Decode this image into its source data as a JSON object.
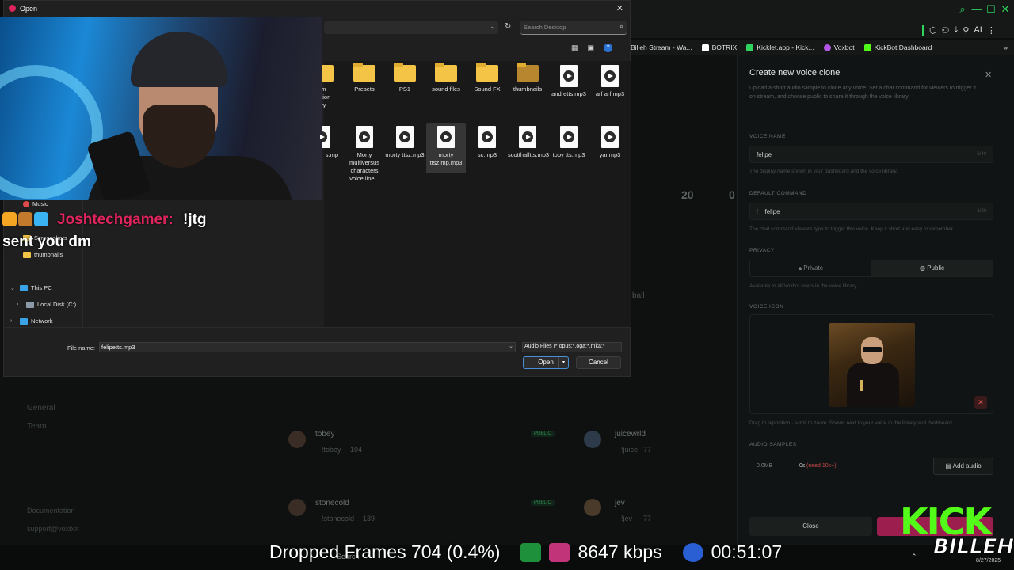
{
  "browser": {
    "bookmarks": [
      {
        "label": "Billeh Stream - Wa...",
        "color": "#222222"
      },
      {
        "label": "BOTRIX",
        "color": "#ffffff"
      },
      {
        "label": "Kicklet.app - Kick...",
        "color": "#2fd45e"
      },
      {
        "label": "Voxbot",
        "color": "#b156e6"
      },
      {
        "label": "KickBot Dashboard",
        "color": "#53fc18"
      }
    ],
    "toolbar_ai_label": "AI"
  },
  "dashboard": {
    "stat_value": "20",
    "stat_value2": "0",
    "nav": [
      "General",
      "Team"
    ],
    "footer_links": [
      "Documentation",
      "support@voxbot"
    ],
    "rows": [
      {
        "name": "tobey",
        "cmd": "!tobey",
        "count": "104"
      },
      {
        "name": "juicewrld",
        "cmd": "!juice",
        "count": "77"
      },
      {
        "name": "stonecold",
        "cmd": "!stonecold",
        "count": "139"
      },
      {
        "name": "jev",
        "cmd": "!jev",
        "count": "77"
      }
    ],
    "row_partial": "ball",
    "badge": "PUBLIC"
  },
  "panel": {
    "title": "Create new voice clone",
    "description": "Upload a short audio sample to clone any voice. Set a chat command for viewers to trigger it on stream, and choose public to share it through the voice library.",
    "voice_name_label": "VOICE NAME",
    "voice_name_value": "felipe",
    "voice_name_count": "6/40",
    "voice_name_hint": "The display name shown in your dashboard and the voice library.",
    "command_label": "DEFAULT COMMAND",
    "command_prefix": "!",
    "command_value": "felipe",
    "command_count": "6/20",
    "command_hint": "The chat command viewers type to trigger this voice. Keep it short and easy to remember.",
    "privacy_label": "PRIVACY",
    "privacy_private": "Private",
    "privacy_public": "Public",
    "privacy_hint": "Available to all Voxbot users in the voice library.",
    "icon_label": "VOICE ICON",
    "icon_hint": "Drag to reposition · scroll to zoom. Shown next to your voice in the library and dashboard.",
    "audio_label": "AUDIO SAMPLES",
    "audio_size": "0.0MB",
    "audio_duration": "0s",
    "audio_need": "(need 10s+)",
    "add_audio_label": "Add audio",
    "close_label": "Close"
  },
  "dialog": {
    "title": "Open",
    "search_placeholder": "Search Desktop",
    "files_row1": [
      {
        "label": "um ation ary",
        "kind": "folder"
      },
      {
        "label": "Presets",
        "kind": "folder"
      },
      {
        "label": "PS1",
        "kind": "folder"
      },
      {
        "label": "sound files",
        "kind": "folder"
      },
      {
        "label": "Sound FX",
        "kind": "folder"
      },
      {
        "label": "thumbnails",
        "kind": "folder"
      },
      {
        "label": "andretts.mp3",
        "kind": "audio"
      },
      {
        "label": "arf arf.mp3",
        "kind": "audio"
      }
    ],
    "files_row2": [
      {
        "label": "s.mp",
        "kind": "audio"
      },
      {
        "label": "Morty multiversus characters voice line...",
        "kind": "audio"
      },
      {
        "label": "morty ttsz.mp3",
        "kind": "audio"
      },
      {
        "label": "morty ttsz.mp.mp3",
        "kind": "audio",
        "selected": true
      },
      {
        "label": "sc.mp3",
        "kind": "audio"
      },
      {
        "label": "scotthalltts.mp3",
        "kind": "audio"
      },
      {
        "label": "toby tts.mp3",
        "kind": "audio"
      },
      {
        "label": "yar.mp3",
        "kind": "audio"
      }
    ],
    "nav": {
      "music": "Music",
      "screenshots": "Screenshots",
      "thumbnails": "thumbnails",
      "this_pc": "This PC",
      "local_disk": "Local Disk (C:)",
      "network": "Network"
    },
    "file_name_label": "File name:",
    "file_name_value": "felipetts.mp3",
    "file_type_value": "Audio Files (*.opus;*.oga;*.mka;*",
    "open_label": "Open",
    "cancel_label": "Cancel"
  },
  "chat": {
    "username": "Joshtechgamer:",
    "message_line1": "!jtg",
    "message_line2": "sent you dm"
  },
  "stream": {
    "dropped_frames": "Dropped Frames 704 (0.4%)",
    "bitrate": "8647 kbps",
    "uptime": "00:51:07",
    "kick_text": "KICK",
    "billeh_text": "BILLEH",
    "date": "8/27/2025",
    "search_label": "Search"
  }
}
